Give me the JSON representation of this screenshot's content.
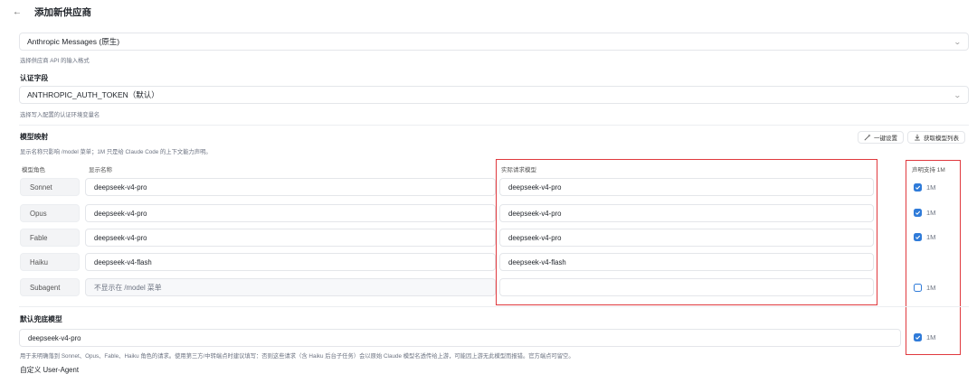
{
  "header": {
    "back_icon": "arrow-left-icon",
    "title": "添加新供应商"
  },
  "api_format": {
    "value": "Anthropic Messages (原生)",
    "help": "选择供应商 API 的输入格式"
  },
  "auth": {
    "label": "认证字段",
    "value": "ANTHROPIC_AUTH_TOKEN（默认）",
    "help": "选择写入配置的认证环境变量名"
  },
  "mapping": {
    "label": "模型映射",
    "help": "显示名称只影响 /model 菜单；1M 只是给 Claude Code 的上下文能力声明。",
    "one_click_label": "一键设置",
    "fetch_label": "获取模型列表",
    "col_role": "模型角色",
    "col_display": "显示名称",
    "col_actual": "实际请求模型",
    "col_1m": "声明支持 1M",
    "rows": [
      {
        "role": "Sonnet",
        "display": "deepseek-v4-pro",
        "actual": "deepseek-v4-pro",
        "flag": "1M"
      },
      {
        "role": "Opus",
        "display": "deepseek-v4-pro",
        "actual": "deepseek-v4-pro",
        "flag": "1M"
      },
      {
        "role": "Fable",
        "display": "deepseek-v4-pro",
        "actual": "deepseek-v4-pro",
        "flag": "1M"
      },
      {
        "role": "Haiku",
        "display": "deepseek-v4-flash",
        "actual": "deepseek-v4-flash",
        "flag": ""
      },
      {
        "role": "Subagent",
        "display": "不显示在 /model 菜单",
        "actual": "",
        "flag": "1M"
      }
    ]
  },
  "fallback": {
    "label": "默认兜底模型",
    "value": "deepseek-v4-pro",
    "flag": "1M",
    "help": "用于未明确落到 Sonnet、Opus、Fable、Haiku 角色的请求。使用第三方/中转端点时建议填写：否则这些请求（含 Haiku 后台子任务）会以原始 Claude 模型名透传给上游，可能因上游无此模型而报错。官方端点可留空。"
  },
  "user_agent": {
    "label": "自定义 User-Agent"
  },
  "colors": {
    "accent": "#2f7bd9",
    "highlight_border": "#e0393e"
  }
}
